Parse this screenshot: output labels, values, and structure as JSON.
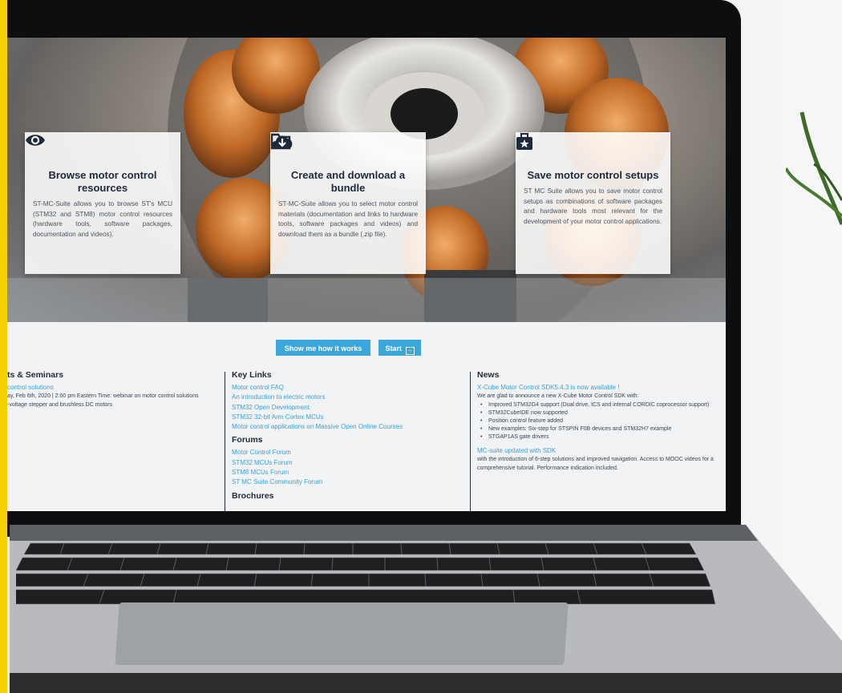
{
  "hero": {
    "cards": [
      {
        "title": "Browse motor control resources",
        "text": "ST-MC-Suite allows you to browse ST's MCU (STM32 and STM8) motor control resources (hardware tools, software packages, documentation and videos).",
        "icons": [
          "eye-icon"
        ]
      },
      {
        "title": "Create and download a bundle",
        "text": "ST-MC-Suite allows you to select motor control materials (documentation and links to hardware tools, software packages and videos) and download them as a bundle (.zip file).",
        "icons": [
          "folder-icon",
          "cloud-download-icon"
        ]
      },
      {
        "title": "Save motor control setups",
        "text": "ST MC Suite allows you to save motor control setups as combinations of software packages and hardware tools most relevant for the development of your motor control applications.",
        "icons": [
          "briefcase-star-icon"
        ]
      }
    ]
  },
  "actions": {
    "show_label": "Show me how it works",
    "start_label": "Start"
  },
  "events": {
    "heading": "ts & Seminars",
    "link": "control solutions",
    "lines": [
      "ay, Feb 6th, 2020 | 2:00 pm Eastern Time: webinar on motor control solutions",
      "-voltage stepper and brushless DC motors"
    ]
  },
  "key_links": {
    "heading": "Key Links",
    "links": [
      "Motor control FAQ",
      "An introduction to electric motors",
      "STM32 Open Development",
      "STM32 32-bit Arm Cortex MCUs",
      "Motor control applications on Massive Open Online Courses"
    ],
    "forums_heading": "Forums",
    "forums": [
      "Motor Control Forum",
      "STM32 MCUs Forum",
      "STM8 MCUs Forum",
      "ST MC Suite Community Forum"
    ],
    "brochures_heading": "Brochures"
  },
  "news": {
    "heading": "News",
    "item1_title": "X-Cube Motor Control SDK5.4.3 is now available !",
    "item1_intro": "We are glad to announce a new X-Cube Motor Control SDK with:",
    "item1_bullets": [
      "Improved STM32G4 support (Dual drive, ICS and internal CORDIC coprocessor support)",
      "STM32CubeIDE now supported",
      "Position control feature added",
      "New examples: Six-step for STSPIN F0B devices and STM32H7 example",
      "STGAP1AS gate drivers"
    ],
    "item2_title": "MC-suite updated with SDK",
    "item2_text": "with the introduction of 6-step solutions and improved navigation. Access to MOOC videos for a comprehensive tutorial. Performance indication included."
  }
}
